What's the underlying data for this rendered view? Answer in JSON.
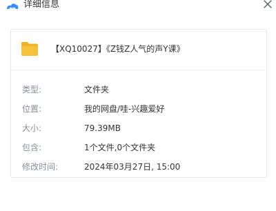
{
  "window": {
    "title": "详细信息",
    "app_icon": "cloud-logo-icon",
    "close_icon": "close-icon"
  },
  "file": {
    "icon": "folder-icon",
    "icon_color": "#f7c23b",
    "name": "【XQ10027】《Z钱Z人气的声Y课》"
  },
  "details": {
    "type": {
      "label": "类型:",
      "value": "文件夹"
    },
    "location": {
      "label": "位置:",
      "value": "我的网盘/哇-兴趣爱好"
    },
    "size": {
      "label": "大小:",
      "value": "79.39MB"
    },
    "contains": {
      "label": "包含:",
      "value": "1个文件,0个文件夹"
    },
    "modified": {
      "label": "修改时间:",
      "value": "2024年03月27日, 15:00"
    }
  },
  "colors": {
    "label_text": "#8a8f99",
    "value_text": "#333333",
    "card_border": "#e6e8ec",
    "logo_blue": "#3a8bff"
  }
}
